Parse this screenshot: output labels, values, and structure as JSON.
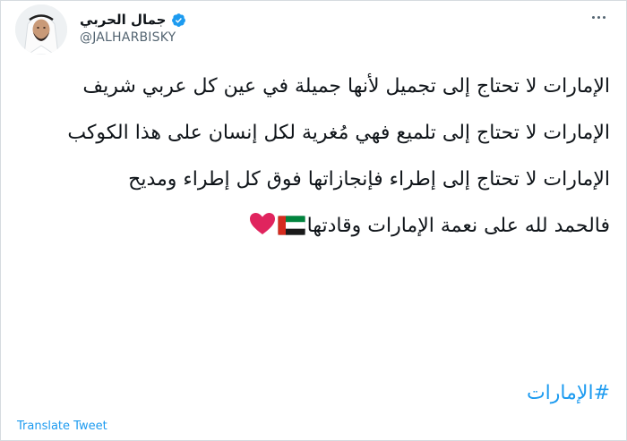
{
  "tweet": {
    "author_name": "جمال الحربي",
    "handle": "@JALHARBISKY",
    "paragraphs": [
      "الإمارات لا تحتاج إلى تجميل لأنها جميلة في عين كل عربي شريف",
      "الإمارات لا تحتاج إلى تلميع فهي مُغرية لكل إنسان على هذا الكوكب",
      "الإمارات لا تحتاج إلى إطراء فإنجازاتها فوق كل إطراء ومديح",
      "فالحمد لله على نعمة الإمارات وقادتها"
    ],
    "hashtag": "#الإمارات",
    "translate_label": "Translate Tweet"
  },
  "icons": {
    "verified": "verified-badge-icon",
    "more": "more-options-icon",
    "flag": "uae-flag-emoji",
    "heart": "red-heart-emoji"
  },
  "colors": {
    "link": "#1d9bf0",
    "text": "#0f1419",
    "secondary": "#536471",
    "heart": "#e0245e"
  }
}
